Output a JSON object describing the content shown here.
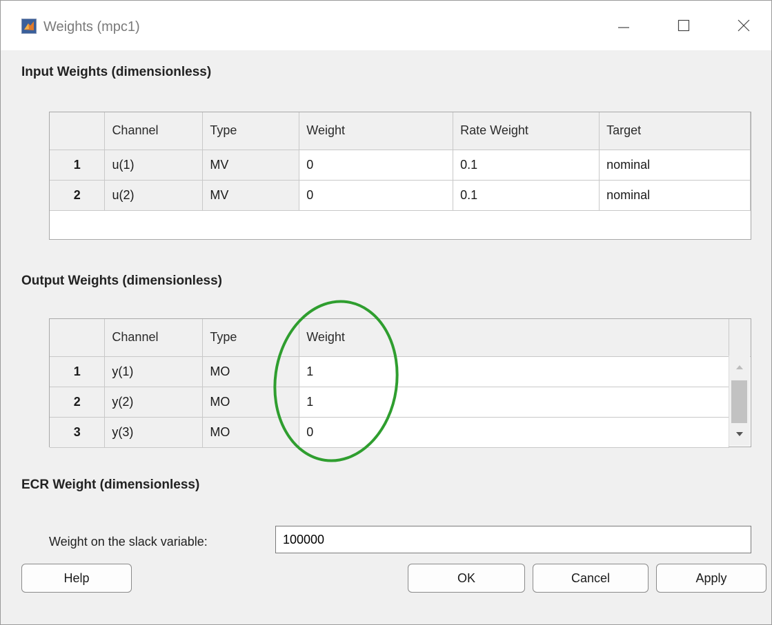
{
  "window": {
    "title": "Weights (mpc1)"
  },
  "input_section": {
    "title": "Input Weights (dimensionless)",
    "columns": [
      "",
      "Channel",
      "Type",
      "Weight",
      "Rate Weight",
      "Target"
    ],
    "rows": [
      {
        "num": "1",
        "channel": "u(1)",
        "type": "MV",
        "weight": "0",
        "rate_weight": "0.1",
        "target": "nominal"
      },
      {
        "num": "2",
        "channel": "u(2)",
        "type": "MV",
        "weight": "0",
        "rate_weight": "0.1",
        "target": "nominal"
      }
    ]
  },
  "output_section": {
    "title": "Output Weights (dimensionless)",
    "columns": [
      "",
      "Channel",
      "Type",
      "Weight"
    ],
    "rows": [
      {
        "num": "1",
        "channel": "y(1)",
        "type": "MO",
        "weight": "1"
      },
      {
        "num": "2",
        "channel": "y(2)",
        "type": "MO",
        "weight": "1"
      },
      {
        "num": "3",
        "channel": "y(3)",
        "type": "MO",
        "weight": "0"
      }
    ]
  },
  "ecr_section": {
    "title": "ECR Weight (dimensionless)",
    "label": "Weight on the slack variable:",
    "value": "100000"
  },
  "buttons": {
    "help": "Help",
    "ok": "OK",
    "cancel": "Cancel",
    "apply": "Apply"
  },
  "colors": {
    "annotation": "#2f9e2f",
    "header_bg": "#f0f0f0",
    "border": "#a8a8a8"
  },
  "icons": [
    "matlab-logo-icon",
    "minimize-icon",
    "maximize-icon",
    "close-icon",
    "scroll-up-icon",
    "scroll-down-icon"
  ]
}
